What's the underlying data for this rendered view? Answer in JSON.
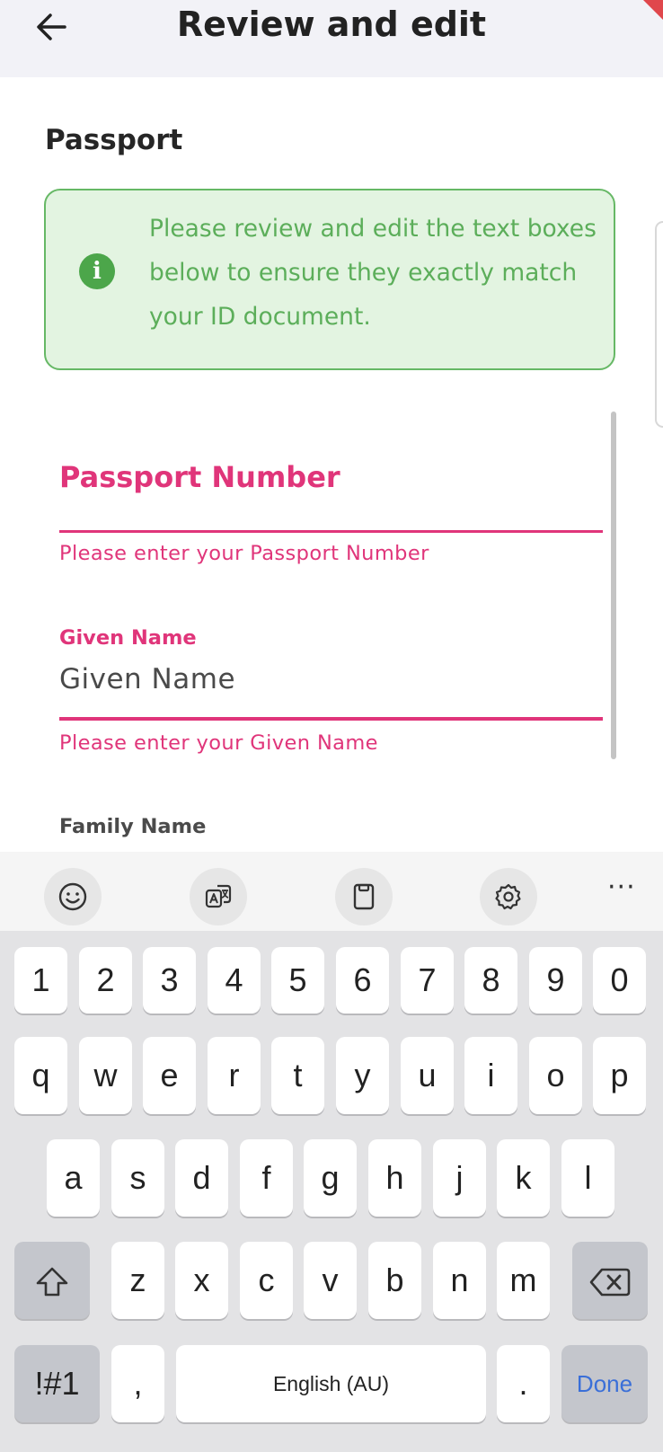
{
  "header": {
    "title": "Review and edit",
    "back_icon": "arrow-left-icon"
  },
  "document": {
    "title": "Passport"
  },
  "info_banner": {
    "icon": "info-icon",
    "text": "Please review and edit the text boxes below to ensure they exactly match your ID document."
  },
  "form": {
    "passport_number": {
      "label": "Passport Number",
      "value": "",
      "error": "Please enter your Passport Number"
    },
    "given_name": {
      "label": "Given Name",
      "placeholder": "Given Name",
      "error": "Please enter your Given Name"
    },
    "family_name": {
      "label": "Family Name"
    }
  },
  "keyboard_toolbar": {
    "icons": [
      "emoji-icon",
      "translate-icon",
      "clipboard-icon",
      "settings-icon"
    ],
    "more": "···"
  },
  "keyboard": {
    "row1": [
      "1",
      "2",
      "3",
      "4",
      "5",
      "6",
      "7",
      "8",
      "9",
      "0"
    ],
    "row2": [
      "q",
      "w",
      "e",
      "r",
      "t",
      "y",
      "u",
      "i",
      "o",
      "p"
    ],
    "row3": [
      "a",
      "s",
      "d",
      "f",
      "g",
      "h",
      "j",
      "k",
      "l"
    ],
    "row4": [
      "z",
      "x",
      "c",
      "v",
      "b",
      "n",
      "m"
    ],
    "symbols": "!#1",
    "comma": ",",
    "space": "English (AU)",
    "period": ".",
    "done": "Done"
  },
  "colors": {
    "accent": "#E0357A",
    "success_text": "#5CAE5A",
    "success_bg": "#E3F4E1",
    "done_blue": "#3A6FD8"
  }
}
